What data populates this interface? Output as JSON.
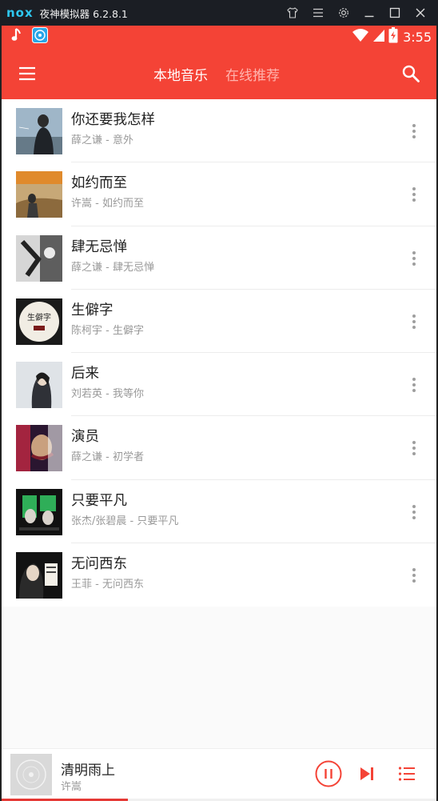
{
  "emulator": {
    "logo": "nox",
    "title": "夜神模拟器 6.2.8.1",
    "controls": [
      "tshirt-icon",
      "menu-icon",
      "gear-icon",
      "minimize-icon",
      "maximize-icon",
      "close-icon"
    ]
  },
  "status_bar": {
    "time": "3:55"
  },
  "app_bar": {
    "tabs": [
      {
        "label": "本地音乐",
        "active": true
      },
      {
        "label": "在线推荐",
        "active": false
      }
    ]
  },
  "songs": [
    {
      "title": "你还要我怎样",
      "subtitle": "薛之谦 - 意外"
    },
    {
      "title": "如约而至",
      "subtitle": "许嵩 - 如约而至"
    },
    {
      "title": "肆无忌惮",
      "subtitle": "薛之谦 - 肆无忌惮"
    },
    {
      "title": "生僻字",
      "subtitle": "陈柯宇 - 生僻字"
    },
    {
      "title": "后来",
      "subtitle": "刘若英 - 我等你"
    },
    {
      "title": "演员",
      "subtitle": "薛之谦 - 初学者"
    },
    {
      "title": "只要平凡",
      "subtitle": "张杰/张碧晨 - 只要平凡"
    },
    {
      "title": "无问西东",
      "subtitle": "王菲 - 无问西东"
    }
  ],
  "player": {
    "title": "清明雨上",
    "artist": "许嵩",
    "progress": 0.29
  },
  "colors": {
    "accent": "#f44336",
    "progress": "#e53935"
  }
}
